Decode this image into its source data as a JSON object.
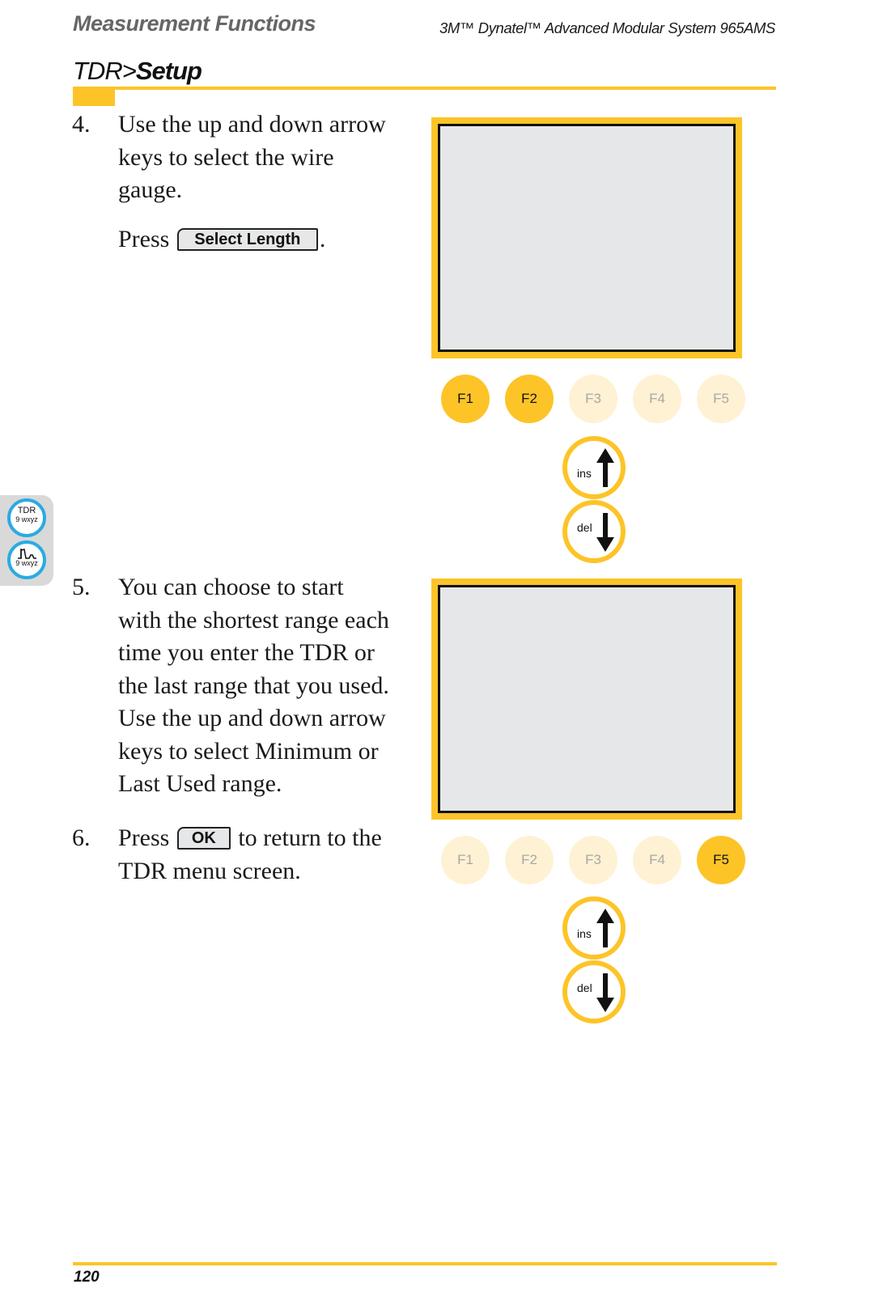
{
  "header": {
    "section": "Measurement Functions",
    "product": "3M™ Dynatel™ Advanced Modular System 965AMS"
  },
  "title": {
    "prefix": "TDR>",
    "bold": "Setup"
  },
  "colors": {
    "accent": "#fdc428",
    "accent_light": "#fff1d3",
    "lcd": "#e6e7e8",
    "side_key_ring": "#29abe2"
  },
  "steps": [
    {
      "number": "4.",
      "lines": [
        "Use the up and down arrow",
        "keys to select the wire",
        "gauge."
      ],
      "press_prefix": "Press",
      "key_label": "Select Length",
      "press_suffix": "."
    },
    {
      "number": "5.",
      "lines": [
        "You can choose to start",
        "with the shortest range each",
        "time you enter the TDR or",
        "the last range that you used.",
        "Use the up and down arrow",
        "keys to select Minimum or",
        "Last Used range."
      ]
    },
    {
      "number": "6.",
      "press_prefix": "Press",
      "key_label": "OK",
      "press_suffix": "to return to the",
      "line2": "TDR menu screen."
    }
  ],
  "figures": [
    {
      "function_keys": [
        {
          "label": "F1",
          "active": true
        },
        {
          "label": "F2",
          "active": true
        },
        {
          "label": "F3",
          "active": false
        },
        {
          "label": "F4",
          "active": false
        },
        {
          "label": "F5",
          "active": false
        }
      ],
      "up_key_label": "ins",
      "down_key_label": "del"
    },
    {
      "function_keys": [
        {
          "label": "F1",
          "active": false
        },
        {
          "label": "F2",
          "active": false
        },
        {
          "label": "F3",
          "active": false
        },
        {
          "label": "F4",
          "active": false
        },
        {
          "label": "F5",
          "active": true
        }
      ],
      "up_key_label": "ins",
      "down_key_label": "del"
    }
  ],
  "side_tab": {
    "key1_line1": "TDR",
    "key1_line2": "9 wxyz",
    "key2_line2": "9 wxyz"
  },
  "footer": {
    "page_number": "120"
  }
}
